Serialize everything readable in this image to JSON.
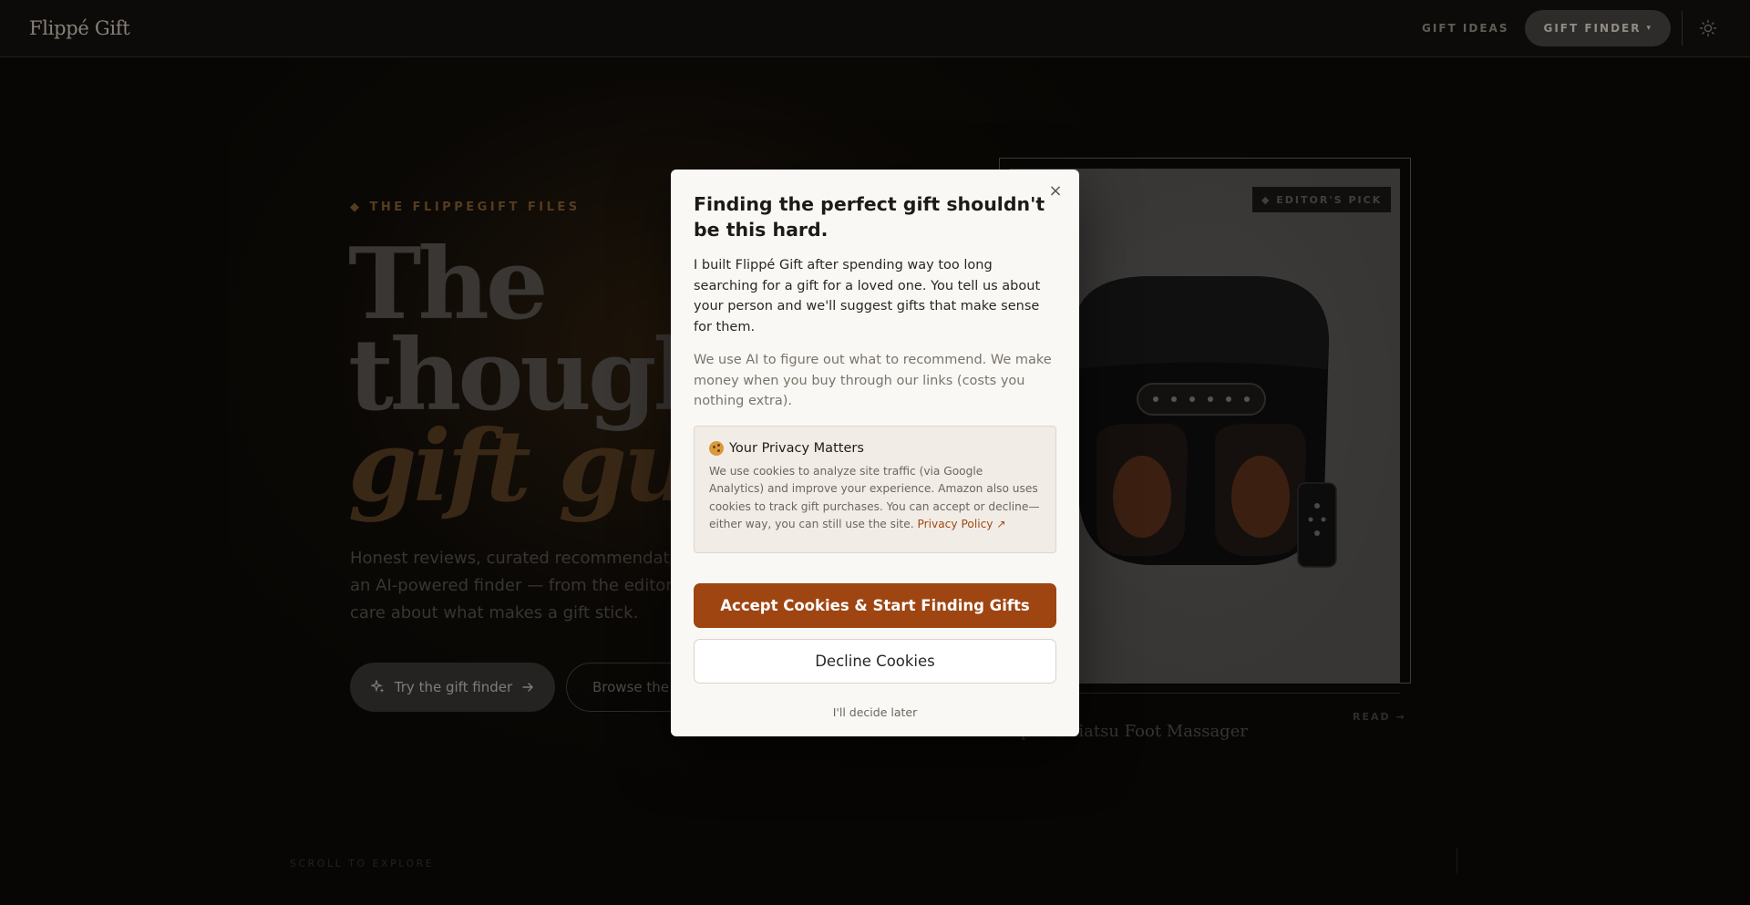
{
  "header": {
    "logo": "Flippé Gift",
    "nav_gift_ideas": "GIFT IDEAS",
    "nav_gift_finder": "GIFT FINDER",
    "nav_gift_finder_caret": "▾"
  },
  "hero": {
    "eyebrow": "◆ THE FLIPPEGIFT FILES",
    "title_line1": "The",
    "title_line2": "thoughtf",
    "title_line3": "gift guid",
    "subtitle": "Honest reviews, curated recommendations, and an AI-powered finder — from the editors who care about what makes a gift stick.",
    "primary_cta": "Try the gift finder",
    "secondary_cta": "Browse the g"
  },
  "featured": {
    "badge": "◆ EDITOR'S PICK",
    "read_label": "READ →",
    "title": "Renpho Shiatsu Foot Massager"
  },
  "scroll_hint": "SCROLL TO EXPLORE",
  "modal": {
    "title": "Finding the perfect gift shouldn't be this hard.",
    "intro": "I built Flippé Gift after spending way too long searching for a gift for a loved one. You tell us about your person and we'll suggest gifts that make sense for them.",
    "note": "We use AI to figure out what to recommend. We make money when you buy through our links (costs you nothing extra).",
    "privacy_heading": "Your Privacy Matters",
    "privacy_text": "We use cookies to analyze site traffic (via Google Analytics) and improve your experience. Amazon also uses cookies to track gift purchases. You can accept or decline—either way, you can still use the site.",
    "privacy_link": "Privacy Policy ↗",
    "accept_label": "Accept Cookies & Start Finding Gifts",
    "decline_label": "Decline Cookies",
    "later_label": "I'll decide later",
    "close_glyph": "×"
  },
  "colors": {
    "accent": "#9e4512",
    "modal_bg": "#faf8f4",
    "page_bg": "#0c0a08"
  },
  "icons": [
    "sparkle-icon",
    "arrow-right-icon",
    "sun-icon",
    "close-icon",
    "cookie-icon"
  ]
}
